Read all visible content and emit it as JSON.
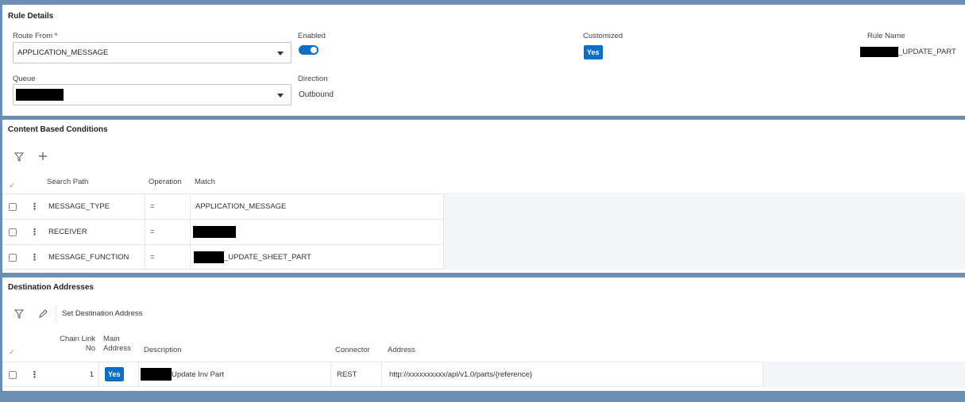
{
  "rule_details": {
    "title": "Rule Details",
    "route_from_label": "Route From",
    "required_mark": "*",
    "route_from_value": "APPLICATION_MESSAGE",
    "enabled_label": "Enabled",
    "customized_label": "Customized",
    "customized_value": "Yes",
    "rule_name_label": "Rule Name",
    "rule_name_value": "_UPDATE_PART",
    "queue_label": "Queue",
    "direction_label": "Direction",
    "direction_value": "Outbound"
  },
  "conditions": {
    "title": "Content Based Conditions",
    "columns": {
      "search_path": "Search Path",
      "operation": "Operation",
      "match": "Match"
    },
    "rows": [
      {
        "search_path": "MESSAGE_TYPE",
        "operation": "=",
        "match": "APPLICATION_MESSAGE"
      },
      {
        "search_path": "RECEIVER",
        "operation": "=",
        "match": ""
      },
      {
        "search_path": "MESSAGE_FUNCTION",
        "operation": "=",
        "match": "_UPDATE_SHEET_PART"
      }
    ]
  },
  "destinations": {
    "title": "Destination Addresses",
    "set_button": "Set Destination Address",
    "columns": {
      "chain_link_1": "Chain Link",
      "chain_link_2": "No",
      "main_address_1": "Main",
      "main_address_2": "Address",
      "description": "Description",
      "connector": "Connector",
      "address": "Address"
    },
    "rows": [
      {
        "chain_link": "1",
        "main_address": "Yes",
        "description": "Update Inv Part",
        "connector": "REST",
        "address": "http://xxxxxxxxxx/api/v1.0/parts/{reference}"
      }
    ]
  },
  "icons": [
    "filter-icon",
    "plus-icon",
    "pencil-icon",
    "checkmark-icon",
    "kebab-icon",
    "chevron-down-icon"
  ],
  "colors": {
    "accent": "#0b6fc7",
    "background": "#6b8fb3"
  }
}
